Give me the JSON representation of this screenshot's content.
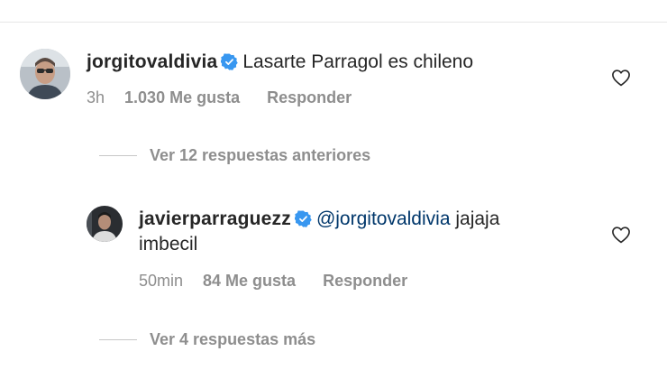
{
  "comment": {
    "username": "jorgitovaldivia",
    "text": "Lasarte Parragol es chileno",
    "time": "3h",
    "likes": "1.030 Me gusta",
    "reply_label": "Responder"
  },
  "view_previous_replies": "Ver 12 respuestas anteriores",
  "reply": {
    "username": "javierparraguezz",
    "mention": "@jorgitovaldivia",
    "text_after_mention": " jajaja",
    "text_line2": "imbecil",
    "time": "50min",
    "likes": "84 Me gusta",
    "reply_label": "Responder"
  },
  "view_more_replies": "Ver 4 respuestas más",
  "colors": {
    "verified_badge": "#3897f0",
    "mention": "#00376b",
    "secondary_text": "#8e8e8e"
  },
  "icons": [
    "verified-badge-icon",
    "heart-outline-icon"
  ]
}
